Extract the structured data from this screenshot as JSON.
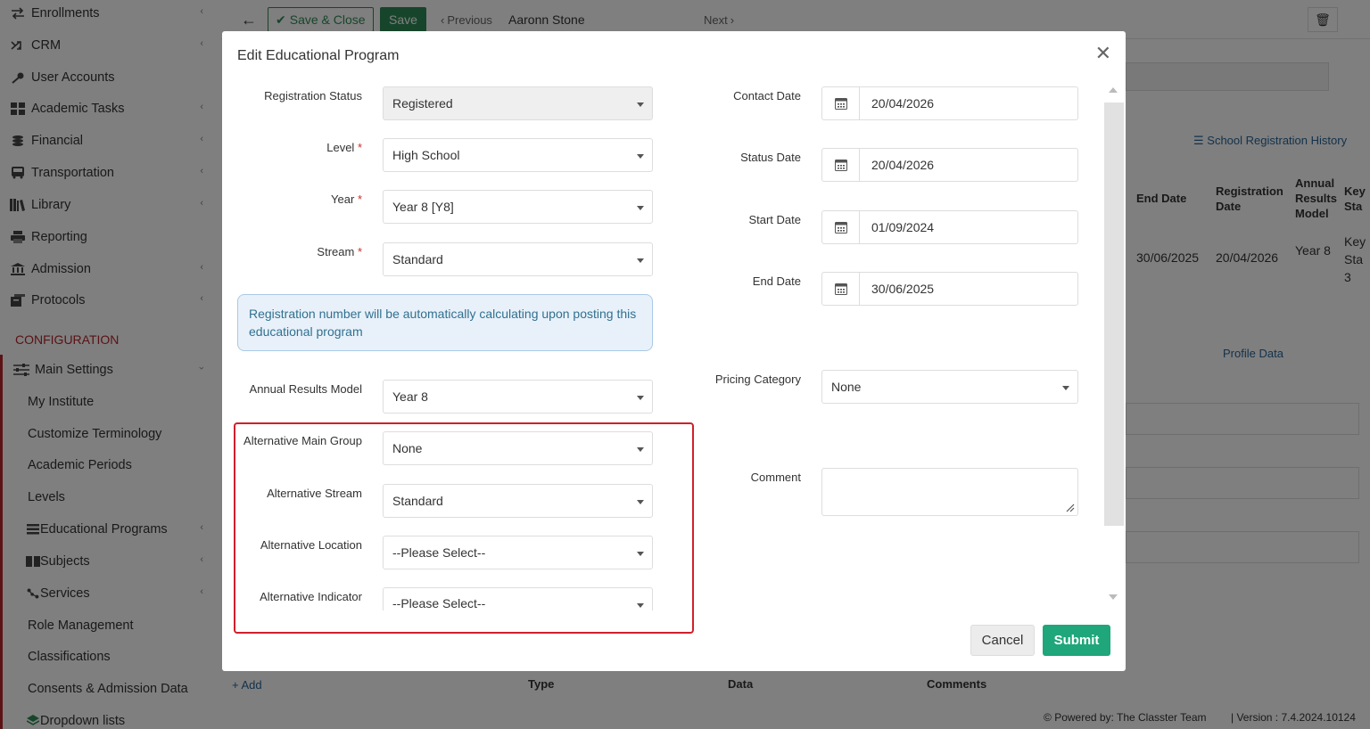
{
  "sidebar": {
    "items": [
      {
        "label": "Enrollments",
        "icon": "exchange-icon"
      },
      {
        "label": "CRM",
        "icon": "shuffle-icon"
      },
      {
        "label": "User Accounts",
        "icon": "key-icon"
      },
      {
        "label": "Academic Tasks",
        "icon": "grid-icon"
      },
      {
        "label": "Financial",
        "icon": "coins-icon"
      },
      {
        "label": "Transportation",
        "icon": "bus-icon"
      },
      {
        "label": "Library",
        "icon": "library-icon"
      },
      {
        "label": "Reporting",
        "icon": "printer-icon"
      },
      {
        "label": "Admission",
        "icon": "bank-icon"
      },
      {
        "label": "Protocols",
        "icon": "archive-icon"
      }
    ],
    "section_label": "CONFIGURATION",
    "main_settings": "Main Settings",
    "sub_items": [
      {
        "label": "My Institute"
      },
      {
        "label": "Customize Terminology"
      },
      {
        "label": "Academic Periods"
      },
      {
        "label": "Levels"
      },
      {
        "label": "Educational Programs"
      },
      {
        "label": "Subjects"
      },
      {
        "label": "Services"
      },
      {
        "label": "Role Management"
      },
      {
        "label": "Classifications"
      },
      {
        "label": "Consents & Admission Data"
      },
      {
        "label": "Dropdown lists"
      }
    ]
  },
  "toolbar": {
    "save_close": "Save & Close",
    "save": "Save",
    "previous": "Previous",
    "student": "Aaronn Stone",
    "next": "Next"
  },
  "background": {
    "history_link": "School Registration History",
    "col_end_date": "End Date",
    "col_reg_date": "Registration Date",
    "col_annual": "Annual Results Model",
    "col_key": "Key Sta",
    "row_end_date": "30/06/2025",
    "row_reg_date": "20/04/2026",
    "row_annual": "Year 8",
    "row_key": "Key Sta 3",
    "profile_data": "Profile Data",
    "add": "Add",
    "col_type": "Type",
    "col_data": "Data",
    "col_comments": "Comments",
    "footer_powered": "Powered by: The Classter Team",
    "footer_version": "| Version : 7.4.2024.10124"
  },
  "modal": {
    "title": "Edit Educational Program",
    "fields": {
      "registration_status": {
        "label": "Registration Status",
        "value": "Registered"
      },
      "level": {
        "label": "Level",
        "value": "High School"
      },
      "year": {
        "label": "Year",
        "value": "Year 8 [Y8]"
      },
      "stream": {
        "label": "Stream",
        "value": "Standard"
      },
      "annual_results_model": {
        "label": "Annual Results Model",
        "value": "Year 8"
      },
      "alt_main_group": {
        "label": "Alternative Main Group",
        "value": "None"
      },
      "alt_stream": {
        "label": "Alternative Stream",
        "value": "Standard"
      },
      "alt_location": {
        "label": "Alternative Location",
        "value": "--Please Select--"
      },
      "alt_indicator": {
        "label": "Alternative Indicator",
        "value": "--Please Select--"
      },
      "contact_date": {
        "label": "Contact Date",
        "value": "20/04/2026"
      },
      "status_date": {
        "label": "Status Date",
        "value": "20/04/2026"
      },
      "start_date": {
        "label": "Start Date",
        "value": "01/09/2024"
      },
      "end_date": {
        "label": "End Date",
        "value": "30/06/2025"
      },
      "pricing_category": {
        "label": "Pricing Category",
        "value": "None"
      },
      "comment": {
        "label": "Comment",
        "value": ""
      }
    },
    "required_mark": "*",
    "info_text": "Registration number will be automatically calculating upon posting this educational program",
    "cancel": "Cancel",
    "submit": "Submit"
  },
  "colors": {
    "accent": "#1fa67a",
    "config_red": "#b7242a",
    "highlight": "#d0202a"
  }
}
